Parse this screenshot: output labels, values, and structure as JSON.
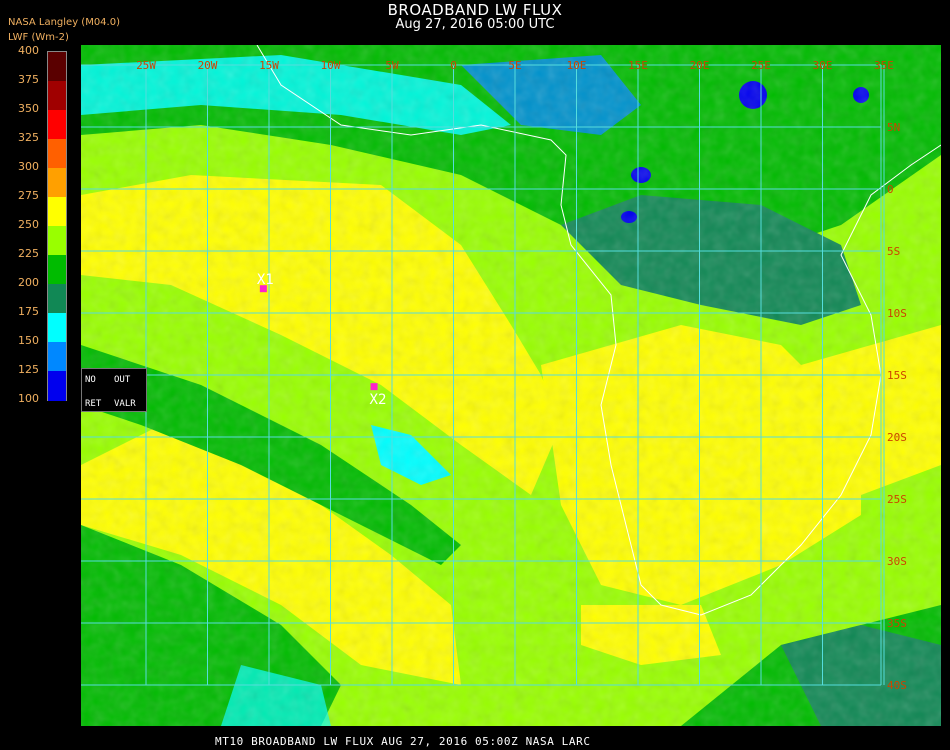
{
  "title": "BROADBAND LW FLUX",
  "subtitle": "Aug 27, 2016 05:00 UTC",
  "legend": {
    "source": "NASA Langley (M04.0)",
    "units": "LWF (Wm-2)",
    "ticks": [
      "400",
      "375",
      "350",
      "325",
      "300",
      "275",
      "250",
      "225",
      "200",
      "175",
      "150",
      "125",
      "100"
    ],
    "colors": [
      "#5a0000",
      "#a00000",
      "#ff0000",
      "#ff6000",
      "#ffa000",
      "#ffff00",
      "#99ff00",
      "#00bb00",
      "#118855",
      "#00ffff",
      "#0088ff",
      "#0000ee",
      "#9933dd"
    ]
  },
  "map": {
    "lon_labels": [
      "25W",
      "20W",
      "15W",
      "10W",
      "5W",
      "0",
      "5E",
      "10E",
      "15E",
      "20E",
      "25E",
      "30E",
      "35E"
    ],
    "lat_labels": [
      "5N",
      "0",
      "5S",
      "10S",
      "15S",
      "20S",
      "25S",
      "30S",
      "35S",
      "40S"
    ],
    "grid_color": "#55dddd",
    "label_color": "#cc4400",
    "markers": [
      {
        "label": "X1",
        "lon": -15.5,
        "lat": -8.0
      },
      {
        "label": "X2",
        "lon": -6.5,
        "lat": -15.9
      }
    ]
  },
  "retrieval_box": {
    "no": "NO",
    "out": "OUT",
    "ret": "RET",
    "valr": "VALR"
  },
  "footer": "MT10  BROADBAND LW FLUX   AUG 27, 2016 05:00Z   NASA LARC"
}
